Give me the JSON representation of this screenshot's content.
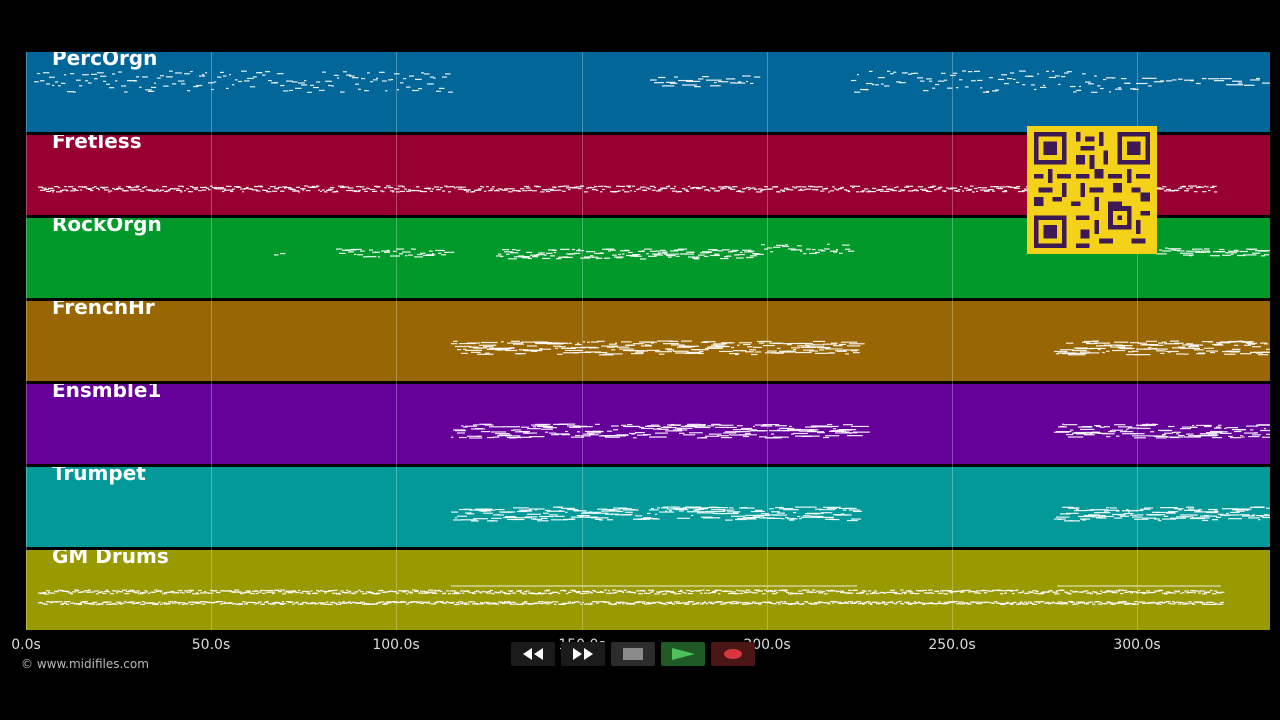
{
  "tracks": [
    {
      "name": "PercOrgn",
      "color": "#026699"
    },
    {
      "name": "Fretless",
      "color": "#990032"
    },
    {
      "name": "RockOrgn",
      "color": "#02992b"
    },
    {
      "name": "FrenchHr",
      "color": "#996604"
    },
    {
      "name": "Ensmble1",
      "color": "#650099"
    },
    {
      "name": "Trumpet",
      "color": "#039999"
    },
    {
      "name": "GM Drums",
      "color": "#999902"
    }
  ],
  "timeline": {
    "ticks": [
      "0.0s",
      "50.0s",
      "100.0s",
      "150.0s",
      "200.0s",
      "250.0s",
      "300.0s"
    ]
  },
  "copyright": "© www.midifiles.com",
  "transport": {
    "buttons": [
      {
        "name": "rewind-button",
        "icon": "rewind-icon"
      },
      {
        "name": "fast-forward-button",
        "icon": "fast-forward-icon"
      },
      {
        "name": "stop-button",
        "icon": "stop-icon"
      },
      {
        "name": "play-button",
        "icon": "play-icon"
      },
      {
        "name": "record-button",
        "icon": "record-icon"
      }
    ]
  },
  "qr_code": {
    "icon": "qr-code-icon",
    "color": "#f5d21a"
  }
}
